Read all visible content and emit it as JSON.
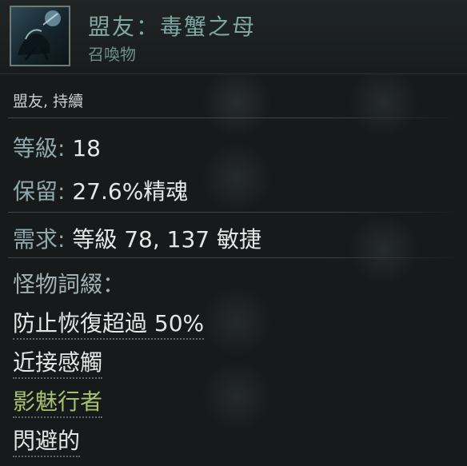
{
  "header": {
    "title": "盟友：毒蟹之母",
    "subtitle": "召喚物",
    "portrait_icon": "crab-mother-portrait-icon"
  },
  "tags": "盟友, 持續",
  "stats": {
    "level_label": "等級:",
    "level_value": "18",
    "reserve_label": "保留:",
    "reserve_value": "27.6%精魂",
    "require_label": "需求:",
    "require_value": "等級 78, 137 敏捷"
  },
  "affixes": {
    "header": "怪物詞綴：",
    "items": [
      {
        "text": "防止恢復超過 50%",
        "color": "#e6e6e6"
      },
      {
        "text": "近接感觸",
        "color": "#e6e6e6"
      },
      {
        "text": "影魅行者",
        "color": "#a7c26f"
      },
      {
        "text": "閃避的",
        "color": "#e6e6e6"
      }
    ]
  },
  "colors": {
    "title": "#7fa7a3",
    "label": "#8fa8ae",
    "value": "#e6e6e6",
    "highlight": "#a7c26f"
  }
}
